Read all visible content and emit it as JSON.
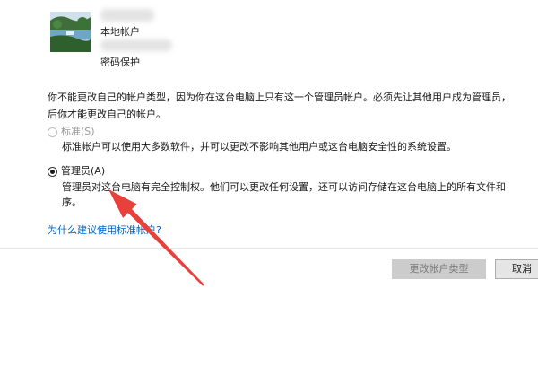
{
  "account": {
    "name_line": "本地帐户",
    "security_line": "密码保护"
  },
  "info": {
    "line1": "你不能更改自己的帐户类型，因为你在这台电脑上只有这一个管理员帐户。必须先让其他用户成为管理员，",
    "line2": "后你才能更改自己的帐户。"
  },
  "options": {
    "standard": {
      "label": "标准(S)",
      "description": "标准帐户可以使用大多数软件，并可以更改不影响其他用户或这台电脑安全性的系统设置。",
      "selected": false,
      "disabled": true
    },
    "admin": {
      "label": "管理员(A)",
      "description_line1": "管理员对这台电脑有完全控制权。他们可以更改任何设置，还可以访问存储在这台电脑上的所有文件和",
      "description_line2": "序。",
      "selected": true
    }
  },
  "help_link": "为什么建议使用标准帐户?",
  "buttons": {
    "change_label": "更改帐户类型",
    "cancel_label": "取消"
  },
  "annotation": {
    "arrow_color": "#e8413c"
  },
  "colors": {
    "link": "#0066cc",
    "disabled_button": "#cccccc"
  }
}
